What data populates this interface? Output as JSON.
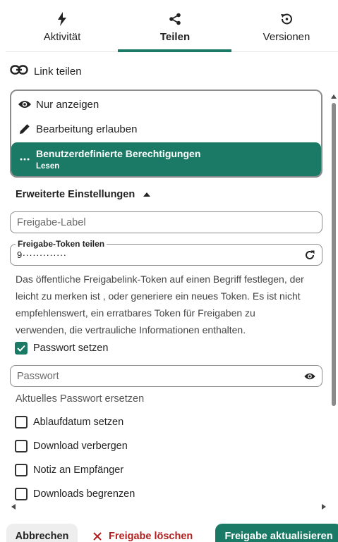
{
  "tabs": [
    {
      "label": "Aktivität",
      "icon": "lightning-icon"
    },
    {
      "label": "Teilen",
      "icon": "share-icon",
      "active": true
    },
    {
      "label": "Versionen",
      "icon": "history-icon"
    }
  ],
  "link_section": {
    "title": "Link teilen",
    "icon": "link-icon"
  },
  "permissions": {
    "options": [
      {
        "label": "Nur anzeigen",
        "icon": "eye-icon"
      },
      {
        "label": "Bearbeitung erlauben",
        "icon": "pencil-icon"
      },
      {
        "label": "Benutzerdefinierte Berechtigungen",
        "sublabel": "Lesen",
        "icon": "dots-icon",
        "selected": true
      }
    ]
  },
  "advanced": {
    "title": "Erweiterte Einstellungen"
  },
  "label_field": {
    "placeholder": "Freigabe-Label"
  },
  "token_field": {
    "label": "Freigabe-Token teilen",
    "value": "9·············"
  },
  "token_description": "Das öffentliche Freigabelink-Token auf einen Begriff festlegen, der leicht zu merken ist , oder generiere ein neues Token. Es ist nicht empfehlenswert, ein erratbares Token für Freigaben zu verwenden, die vertrauliche Informationen enthalten.",
  "password_checkbox": {
    "label": "Passwort setzen",
    "checked": true
  },
  "password_field": {
    "placeholder": "Passwort"
  },
  "password_hint": "Aktuelles Passwort ersetzen",
  "checkboxes": [
    {
      "label": "Ablaufdatum setzen",
      "checked": false
    },
    {
      "label": "Download verbergen",
      "checked": false
    },
    {
      "label": "Notiz an Empfänger",
      "checked": false
    },
    {
      "label": "Downloads begrenzen",
      "checked": false
    }
  ],
  "footer": {
    "cancel": "Abbrechen",
    "delete": "Freigabe löschen",
    "update": "Freigabe aktualisieren"
  },
  "colors": {
    "accent": "#1b7a66",
    "danger": "#b21e1e"
  }
}
